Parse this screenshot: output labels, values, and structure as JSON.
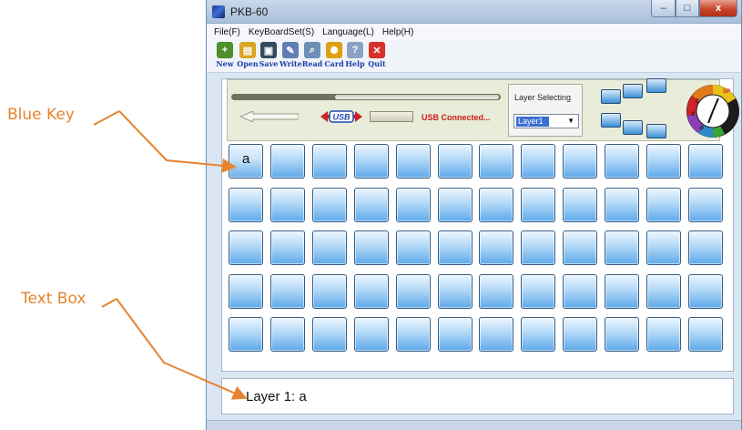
{
  "annotations": {
    "blue_key_label": "Blue Key",
    "text_box_label": "Text Box",
    "color": "#e6842e"
  },
  "window": {
    "title": "PKB-60",
    "controls": {
      "minimize": "–",
      "maximize": "□",
      "close": "x"
    }
  },
  "menu": [
    "File(F)",
    "KeyBoardSet(S)",
    "Language(L)",
    "Help(H)"
  ],
  "toolbar": [
    {
      "label": "New",
      "icon": "new-file-icon",
      "color": "#4f8f2f"
    },
    {
      "label": "Open",
      "icon": "open-folder-icon",
      "color": "#d9a520"
    },
    {
      "label": "Save",
      "icon": "floppy-disk-icon",
      "color": "#34495e"
    },
    {
      "label": "Write",
      "icon": "write-pen-icon",
      "color": "#5f7fb3"
    },
    {
      "label": "Read",
      "icon": "read-magnifier-icon",
      "color": "#6b8fb5"
    },
    {
      "label": "Card",
      "icon": "card-gear-icon",
      "color": "#e0a010"
    },
    {
      "label": "Help",
      "icon": "help-book-icon",
      "color": "#8ba2c4"
    },
    {
      "label": "Quit",
      "icon": "quit-x-icon",
      "color": "#d6302a"
    }
  ],
  "status": {
    "usb_logo_text": "USB",
    "usb_status": "USB Connected...",
    "status_color": "#cc1a1a"
  },
  "layer_selector": {
    "title": "Layer Selecting",
    "selected": "Layer1"
  },
  "dial": {
    "segments": [
      "SP",
      "Z",
      "X",
      "P"
    ],
    "colors": {
      "SP": "#e8c21a",
      "Z": "#e07a1a",
      "X": "#d0202a",
      "P": "#2f86c8",
      "green": "#3aa43a"
    }
  },
  "key_grid": {
    "rows": 5,
    "cols": 12,
    "assigned": {
      "r0c0": "a"
    },
    "key_color": "#5ea9eb"
  },
  "text_box": {
    "value": "Layer 1: a"
  }
}
